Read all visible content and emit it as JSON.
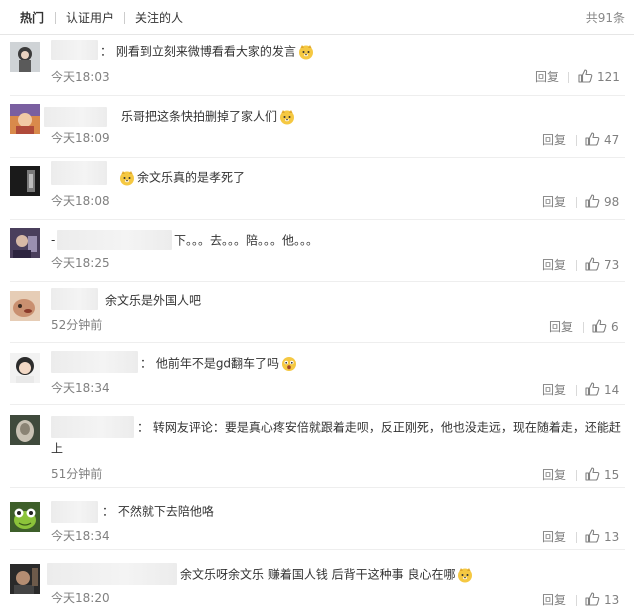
{
  "tabs": {
    "hot": "热门",
    "verified": "认证用户",
    "following": "关注的人"
  },
  "total": "共91条",
  "comments": [
    {
      "text": "： 刚看到立刻来微博看看大家的发言",
      "emoji": "doge",
      "time": "今天18:03",
      "reply": "回复",
      "likes": "121"
    },
    {
      "text": "乐哥把这条快拍删掉了家人们",
      "emoji": "doge",
      "time": "今天18:09",
      "reply": "回复",
      "likes": "47"
    },
    {
      "text": "余文乐真的是孝死了",
      "emoji": "doge",
      "time": "今天18:08",
      "reply": "回复",
      "likes": "98"
    },
    {
      "text_prefix": "-",
      "text": "下。。。去。。。陪。。。他。。。",
      "time": "今天18:25",
      "reply": "回复",
      "likes": "73"
    },
    {
      "text": "余文乐是外国人吧",
      "time": "52分钟前",
      "reply": "回复",
      "likes": "6"
    },
    {
      "text": "： 他前年不是gd翻车了吗",
      "emoji": "surprised",
      "time": "今天18:34",
      "reply": "回复",
      "likes": "14"
    },
    {
      "text": "： 转网友评论：要是真心疼安倍就跟着走呗，反正刚死，他也没走远，现在随着走，还能赶上",
      "time": "51分钟前",
      "reply": "回复",
      "likes": "15"
    },
    {
      "text": "： 不然就下去陪他咯",
      "time": "今天18:34",
      "reply": "回复",
      "likes": "13"
    },
    {
      "text": "余文乐呀余文乐 赚着国人钱 后背干这种事 良心在哪",
      "emoji": "doge",
      "time": "今天18:20",
      "reply": "回复",
      "likes": "13"
    }
  ],
  "colors": {
    "text": "#333333",
    "meta": "#808080",
    "divider": "#eeeeee",
    "emoji": "#f5c842"
  }
}
